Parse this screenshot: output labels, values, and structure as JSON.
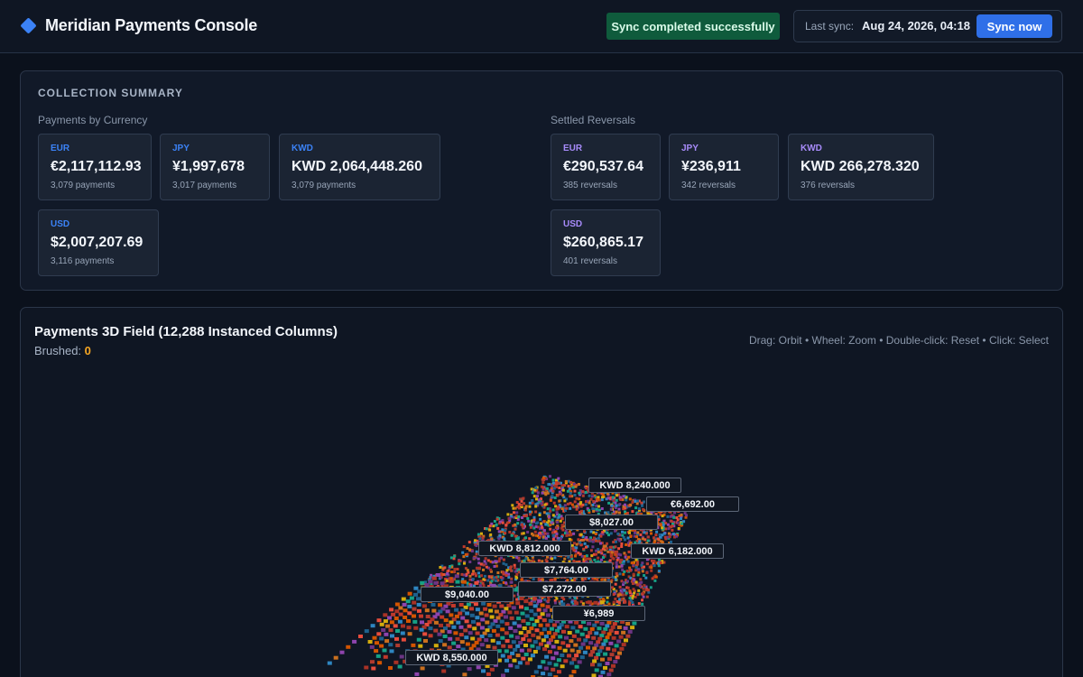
{
  "header": {
    "app_title": "Meridian Payments Console",
    "logo_icon": "diamond-icon",
    "sync_status": "Sync completed successfully",
    "last_sync_label": "Last sync:",
    "last_sync_time": "Aug 24, 2026, 04:18",
    "sync_button": "Sync now"
  },
  "summary": {
    "title": "COLLECTION SUMMARY",
    "payments_label": "Payments by Currency",
    "reversals_label": "Settled Reversals",
    "payments": [
      {
        "currency": "EUR",
        "amount": "€2,117,112.93",
        "count": "3,079 payments"
      },
      {
        "currency": "JPY",
        "amount": "¥1,997,678",
        "count": "3,017 payments"
      },
      {
        "currency": "KWD",
        "amount": "KWD 2,064,448.260",
        "count": "3,079 payments"
      },
      {
        "currency": "USD",
        "amount": "$2,007,207.69",
        "count": "3,116 payments"
      }
    ],
    "reversals": [
      {
        "currency": "EUR",
        "amount": "€290,537.64",
        "count": "385 reversals"
      },
      {
        "currency": "JPY",
        "amount": "¥236,911",
        "count": "342 reversals"
      },
      {
        "currency": "KWD",
        "amount": "KWD 266,278.320",
        "count": "376 reversals"
      },
      {
        "currency": "USD",
        "amount": "$260,865.17",
        "count": "401 reversals"
      }
    ]
  },
  "field": {
    "title": "Payments 3D Field (12,288 Instanced Columns)",
    "brushed_label": "Brushed:",
    "brushed_value": "0",
    "hint": "Drag: Orbit • Wheel: Zoom • Double-click: Reset • Click: Select",
    "labels": [
      "KWD 8,240.000",
      "€6,692.00",
      "$8,027.00",
      "KWD 8,812.000",
      "KWD 6,182.000",
      "$7,764.00",
      "$9,040.00",
      "$7,272.00",
      "¥6,989",
      "KWD 8,550.000"
    ]
  },
  "colors": {
    "accent": "#2f6fe8",
    "success_badge": "#0f5b3c",
    "payment_currency": "#3b82f6",
    "reversal_currency": "#a78bfa",
    "brushed_value": "#f5a623"
  }
}
